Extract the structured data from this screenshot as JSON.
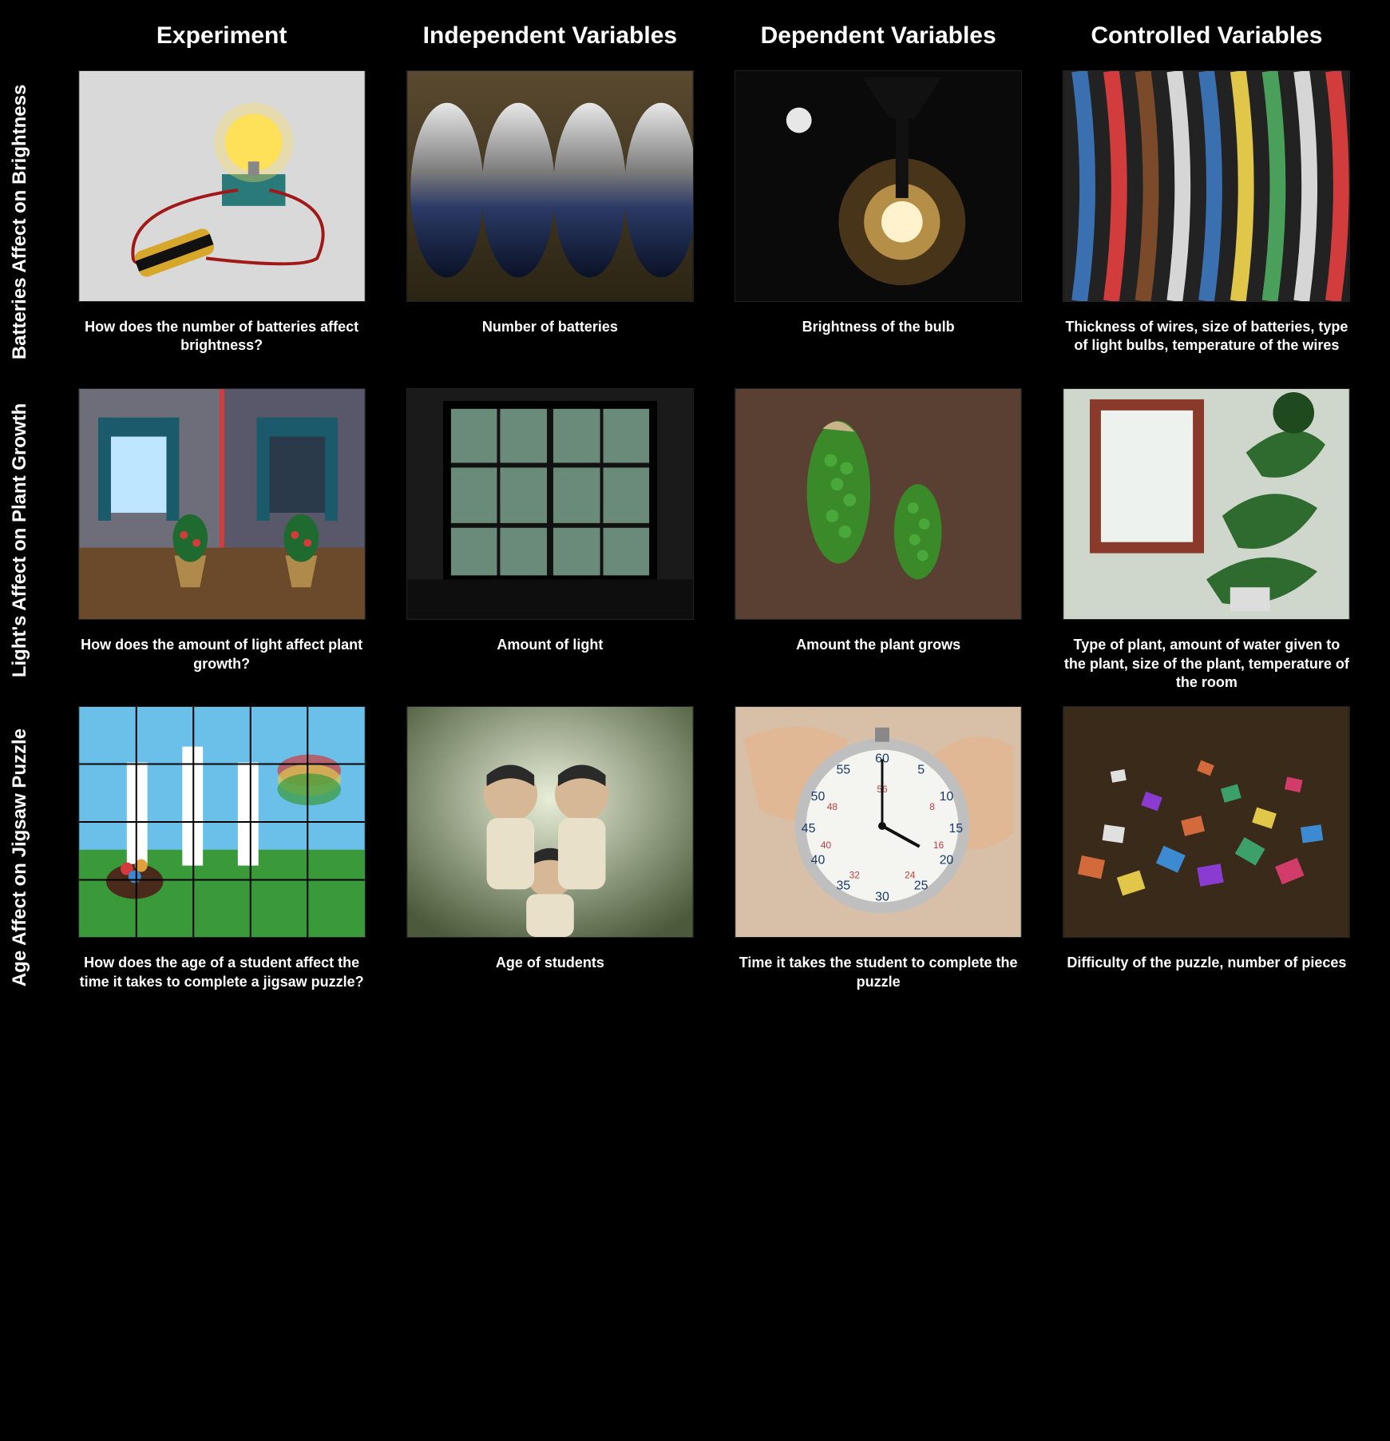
{
  "columns": [
    "Experiment",
    "Independent Variables",
    "Dependent Variables",
    "Controlled Variables"
  ],
  "rows": [
    {
      "label": "Batteries Affect on Brightness",
      "cells": [
        {
          "caption": "How does the number of batteries affect brightness?",
          "img": "circuit"
        },
        {
          "caption": "Number of batteries",
          "img": "batteries"
        },
        {
          "caption": "Brightness of the bulb",
          "img": "bulb"
        },
        {
          "caption": "Thickness of wires, size of batteries, type of light bulbs, temperature of the wires",
          "img": "wires"
        }
      ]
    },
    {
      "label": "Light's Affect on Plant Growth",
      "cells": [
        {
          "caption": "How does the amount of light affect plant growth?",
          "img": "plantrooms"
        },
        {
          "caption": "Amount of light",
          "img": "window"
        },
        {
          "caption": "Amount the plant grows",
          "img": "plantgrow"
        },
        {
          "caption": "Type of plant, amount of water given to the plant, size of the plant, temperature of the room",
          "img": "houseplants"
        }
      ]
    },
    {
      "label": "Age Affect on Jigsaw Puzzle",
      "cells": [
        {
          "caption": "How does the age of a student affect the time it takes to complete a jigsaw puzzle?",
          "img": "puzzle"
        },
        {
          "caption": "Age of students",
          "img": "children"
        },
        {
          "caption": "Time it takes the student to complete the puzzle",
          "img": "stopwatch"
        },
        {
          "caption": "Difficulty of the puzzle, number of pieces",
          "img": "pieces"
        }
      ]
    }
  ]
}
